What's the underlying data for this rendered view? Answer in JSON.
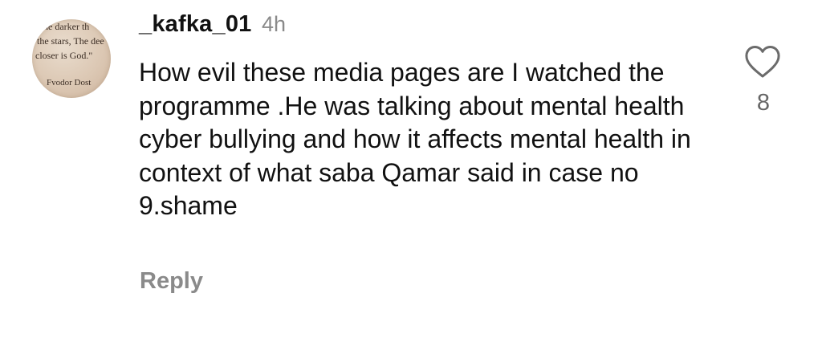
{
  "comment": {
    "avatar": {
      "lines": [
        "he darker th",
        "the stars, The dee",
        "closer is God.\"",
        "Fvodor Dost"
      ]
    },
    "username": "_kafka_01",
    "time": "4h",
    "text": "How evil these media pages are I watched the programme .He was talking about mental health cyber bullying and how it affects mental health in context of what saba Qamar said in case no 9.shame",
    "reply_label": "Reply",
    "like_icon": "heart-outline-icon",
    "like_count": "8"
  },
  "colors": {
    "text": "#111111",
    "muted": "#8a8a8a",
    "count": "#666666"
  }
}
